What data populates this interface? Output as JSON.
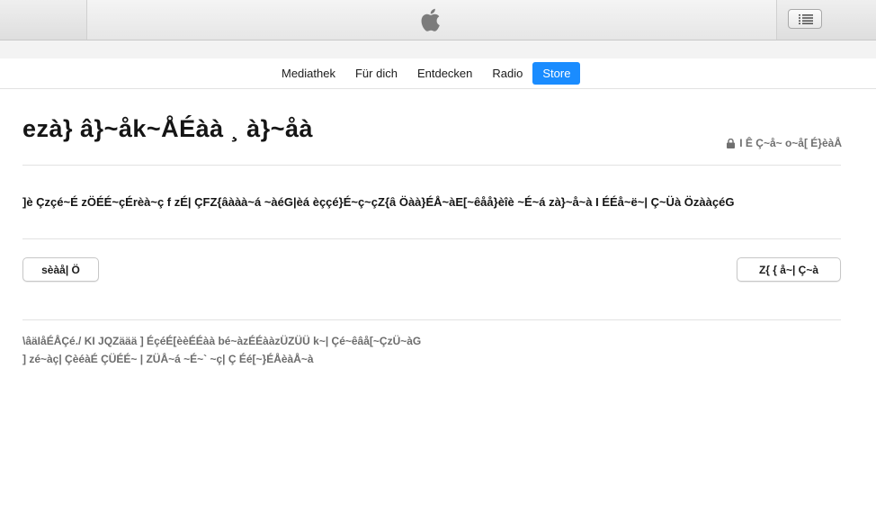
{
  "nav": {
    "tabs": [
      {
        "label": "Mediathek"
      },
      {
        "label": "Für dich"
      },
      {
        "label": "Entdecken"
      },
      {
        "label": "Radio"
      },
      {
        "label": "Store",
        "active": true
      }
    ]
  },
  "main": {
    "heading": "ezà}  â}~åk~ÅÉàà ¸  à}~åà",
    "privacy_label": "I Ê Ç~å~ o~å[ É}èàÅ",
    "paragraph": "]è Çzçé~É zÖÉÉ~çÉrèà~ç f zÉ| ÇFZ{âààà~á ~àéG|èá èççé}É~ç~çZ{â Öàà}ÉÅ~àE[~êåå}èîè ~É~á zà}~å~à I ÉÉå~ë~| Ç~Üà ÖzààçéG",
    "left_button": "sèàå| Ö",
    "right_button": "Z{ { å~| Ç~à",
    "footer_line1": "\\âäIåÉÅÇé./ KI JQZäää ] ÉçéÉ[èèÉÉàà bé~àzÉÉààzÜZÜÜ k~| Çé~êâå[~ÇzÜ~àG",
    "footer_line2": "] zé~àç| ÇèéàÉ ÇÜÉÉ~ | ZÜÅ~á ~É~` ~ç| Ç  Éé[~}ÉÅèàÅ~à"
  },
  "icons": {
    "logo": "apple-logo-icon",
    "list": "list-icon",
    "lock": "lock-icon"
  },
  "colors": {
    "accent": "#1a8cff"
  }
}
